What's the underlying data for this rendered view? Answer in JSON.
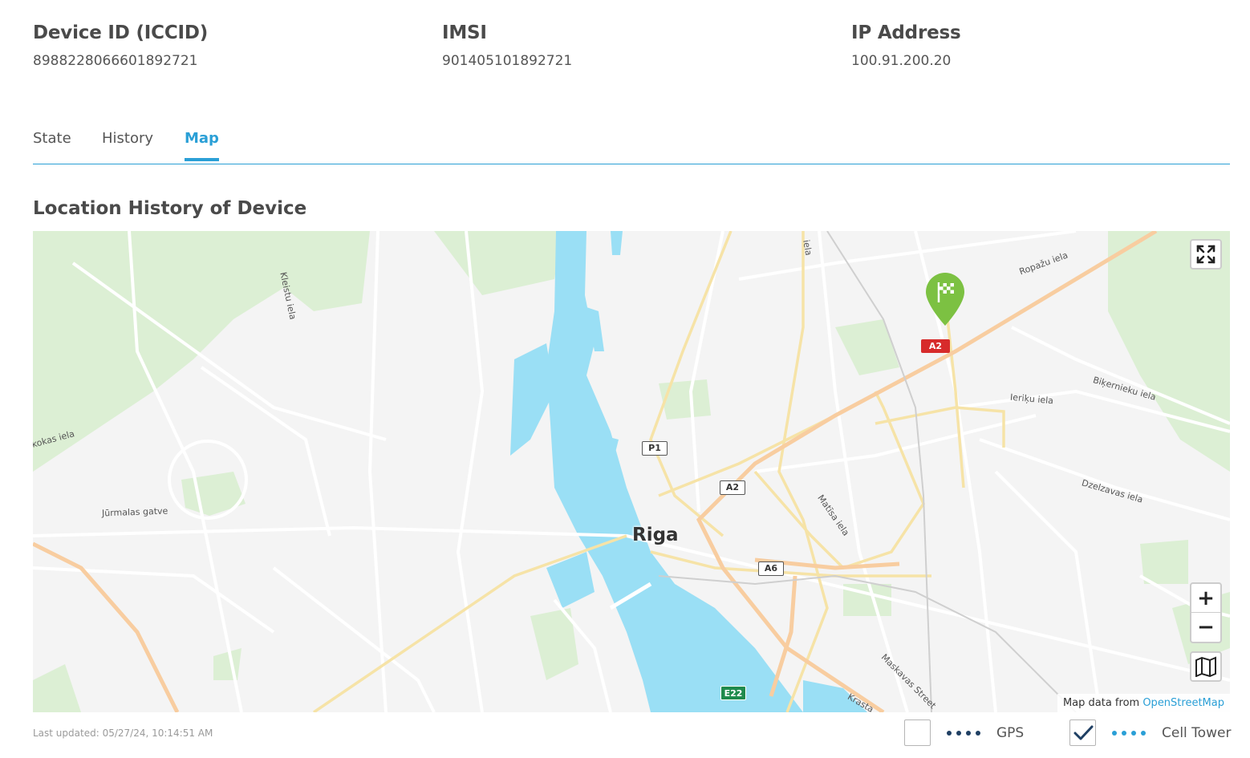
{
  "device_info": {
    "iccid_label": "Device ID (ICCID)",
    "iccid_value": "8988228066601892721",
    "imsi_label": "IMSI",
    "imsi_value": "901405101892721",
    "ip_label": "IP Address",
    "ip_value": "100.91.200.20"
  },
  "tabs": [
    {
      "label": "State",
      "active": false
    },
    {
      "label": "History",
      "active": false
    },
    {
      "label": "Map",
      "active": true
    }
  ],
  "section_title": "Location History of Device",
  "map": {
    "city_label": "Riga",
    "street_labels": {
      "kleistu": "Kleistu iela",
      "ropazu": "Ropažu iela",
      "bikernieku": "Biķernieku iela",
      "ieriku": "Ieriķu iela",
      "dzelzavas": "Dzelzavas iela",
      "jurmalas": "Jūrmalas gatve",
      "kokas": "kokas iela",
      "matisa": "Matīsa iela",
      "maskavas": "Maskavas Street",
      "krasta": "Krasta",
      "top_iela": "iela"
    },
    "road_shields": {
      "a2_top": "A2",
      "p1": "P1",
      "a2_center": "A2",
      "a6": "A6",
      "e22": "E22"
    },
    "attribution_prefix": "Map data from",
    "attribution_link": "OpenStreetMap",
    "controls": {
      "fullscreen_icon": "expand-arrows-icon",
      "zoom_in": "+",
      "zoom_out": "−",
      "layers_icon": "map-fold-icon"
    },
    "marker_icon": "checkered-flag-pin-icon",
    "colors": {
      "water": "#9adff5",
      "park": "#dcefd4",
      "marker": "#7cc142",
      "highway": "#f8cda0"
    }
  },
  "footer": {
    "last_updated": "Last updated: 05/27/24, 10:14:51 AM",
    "legend": [
      {
        "label": "GPS",
        "checked": false,
        "dot_color": "#1f3f63"
      },
      {
        "label": "Cell Tower",
        "checked": true,
        "dot_color": "#2a9fd6"
      }
    ]
  }
}
